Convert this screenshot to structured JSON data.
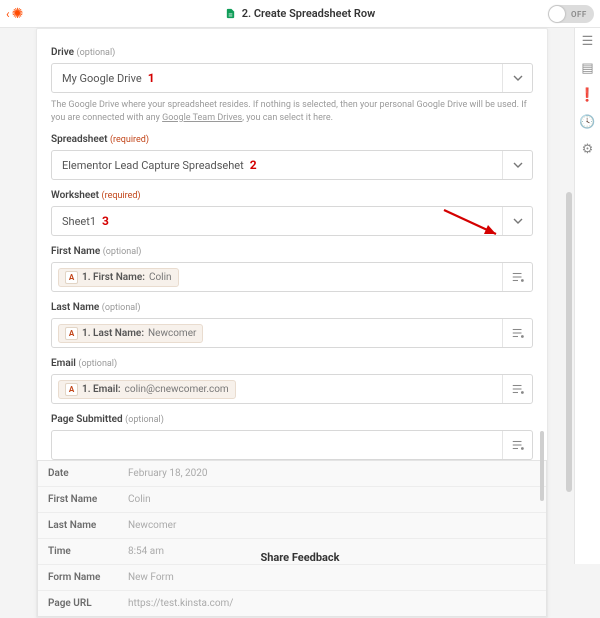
{
  "header": {
    "title": "2. Create Spreadsheet Row",
    "toggle_label": "OFF"
  },
  "drive": {
    "label": "Drive",
    "qualifier": "(optional)",
    "value": "My Google Drive",
    "num": "1",
    "helper_pre": "The Google Drive where your spreadsheet resides. If nothing is selected, then your personal Google Drive will be used. If you are connected with any ",
    "helper_link": "Google Team Drives",
    "helper_post": ", you can select it here."
  },
  "spreadsheet": {
    "label": "Spreadsheet",
    "qualifier": "(required)",
    "value": "Elementor Lead Capture Spreadsehet",
    "num": "2"
  },
  "worksheet": {
    "label": "Worksheet",
    "qualifier": "(required)",
    "value": "Sheet1",
    "num": "3"
  },
  "fields": {
    "first_name": {
      "label": "First Name",
      "qualifier": "(optional)",
      "pill_prefix": "A",
      "pill_key": "1. First Name:",
      "pill_val": "Colin"
    },
    "last_name": {
      "label": "Last Name",
      "qualifier": "(optional)",
      "pill_prefix": "A",
      "pill_key": "1. Last Name:",
      "pill_val": "Newcomer"
    },
    "email": {
      "label": "Email",
      "qualifier": "(optional)",
      "pill_prefix": "A",
      "pill_key": "1. Email:",
      "pill_val": "colin@cnewcomer.com"
    },
    "page_submitted": {
      "label": "Page Submitted",
      "qualifier": "(optional)"
    }
  },
  "preview": [
    {
      "k": "Date",
      "v": "February 18, 2020"
    },
    {
      "k": "First Name",
      "v": "Colin"
    },
    {
      "k": "Last Name",
      "v": "Newcomer"
    },
    {
      "k": "Time",
      "v": "8:54 am"
    },
    {
      "k": "Form Name",
      "v": "New Form"
    },
    {
      "k": "Page URL",
      "v": "https://test.kinsta.com/"
    }
  ],
  "footer": {
    "share": "Share Feedback"
  }
}
